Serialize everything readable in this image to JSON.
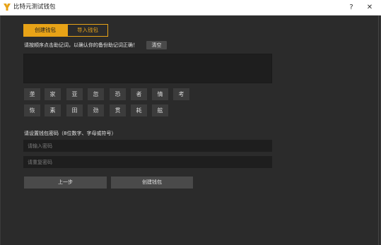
{
  "window": {
    "title": "比特元测试钱包",
    "help_label": "?",
    "close_label": "✕"
  },
  "tabs": [
    {
      "label": "创建钱包",
      "active": true
    },
    {
      "label": "导入钱包",
      "active": false
    }
  ],
  "mnemonic": {
    "instruction": "请按顺序点击助记词，以确认你的备份助记词正确！",
    "clear_label": "清空",
    "words_row1": [
      "垄",
      "家",
      "亚",
      "忽",
      "恐",
      "者",
      "情",
      "考"
    ],
    "words_row2": [
      "恢",
      "素",
      "田",
      "劲",
      "贯",
      "耗",
      "舷"
    ]
  },
  "password": {
    "label": "请设置钱包密码（8位数字、字母或符号）",
    "input_placeholder": "请输入密码",
    "confirm_placeholder": "请重复密码"
  },
  "buttons": {
    "prev_label": "上一步",
    "create_label": "创建钱包"
  },
  "colors": {
    "accent": "#e8a317",
    "background": "#2b2b2b",
    "field": "#1e1e1e",
    "word_chip": "#3c3c3c",
    "button": "#4a4a4a"
  },
  "icons": {
    "app": "bitcoin-wallet-icon"
  }
}
